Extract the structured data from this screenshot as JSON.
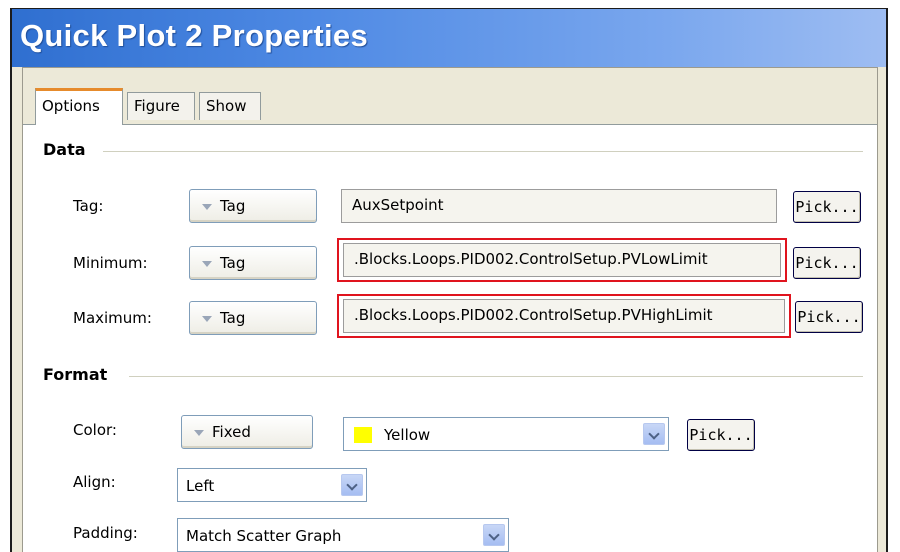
{
  "window": {
    "title": "Quick Plot 2 Properties"
  },
  "tabs": [
    {
      "label": "Options",
      "active": true
    },
    {
      "label": "Figure",
      "active": false
    },
    {
      "label": "Show",
      "active": false
    }
  ],
  "data_section": {
    "heading": "Data",
    "rows": [
      {
        "label": "Tag:",
        "mode": "Tag",
        "value": "AuxSetpoint",
        "pick": "Pick...",
        "highlighted": false
      },
      {
        "label": "Minimum:",
        "mode": "Tag",
        "value": ".Blocks.Loops.PID002.ControlSetup.PVLowLimit",
        "pick": "Pick...",
        "highlighted": true
      },
      {
        "label": "Maximum:",
        "mode": "Tag",
        "value": ".Blocks.Loops.PID002.ControlSetup.PVHighLimit",
        "pick": "Pick...",
        "highlighted": true
      }
    ]
  },
  "format_section": {
    "heading": "Format",
    "color": {
      "label": "Color:",
      "mode": "Fixed",
      "value": "Yellow",
      "swatch": "#ffff00",
      "pick": "Pick..."
    },
    "align": {
      "label": "Align:",
      "value": "Left"
    },
    "padding": {
      "label": "Padding:",
      "value": "Match Scatter Graph"
    }
  },
  "colors": {
    "highlight": "#e0141e",
    "titlebar": "#4f8ae4",
    "active_tab_accent": "#e68b2c"
  }
}
